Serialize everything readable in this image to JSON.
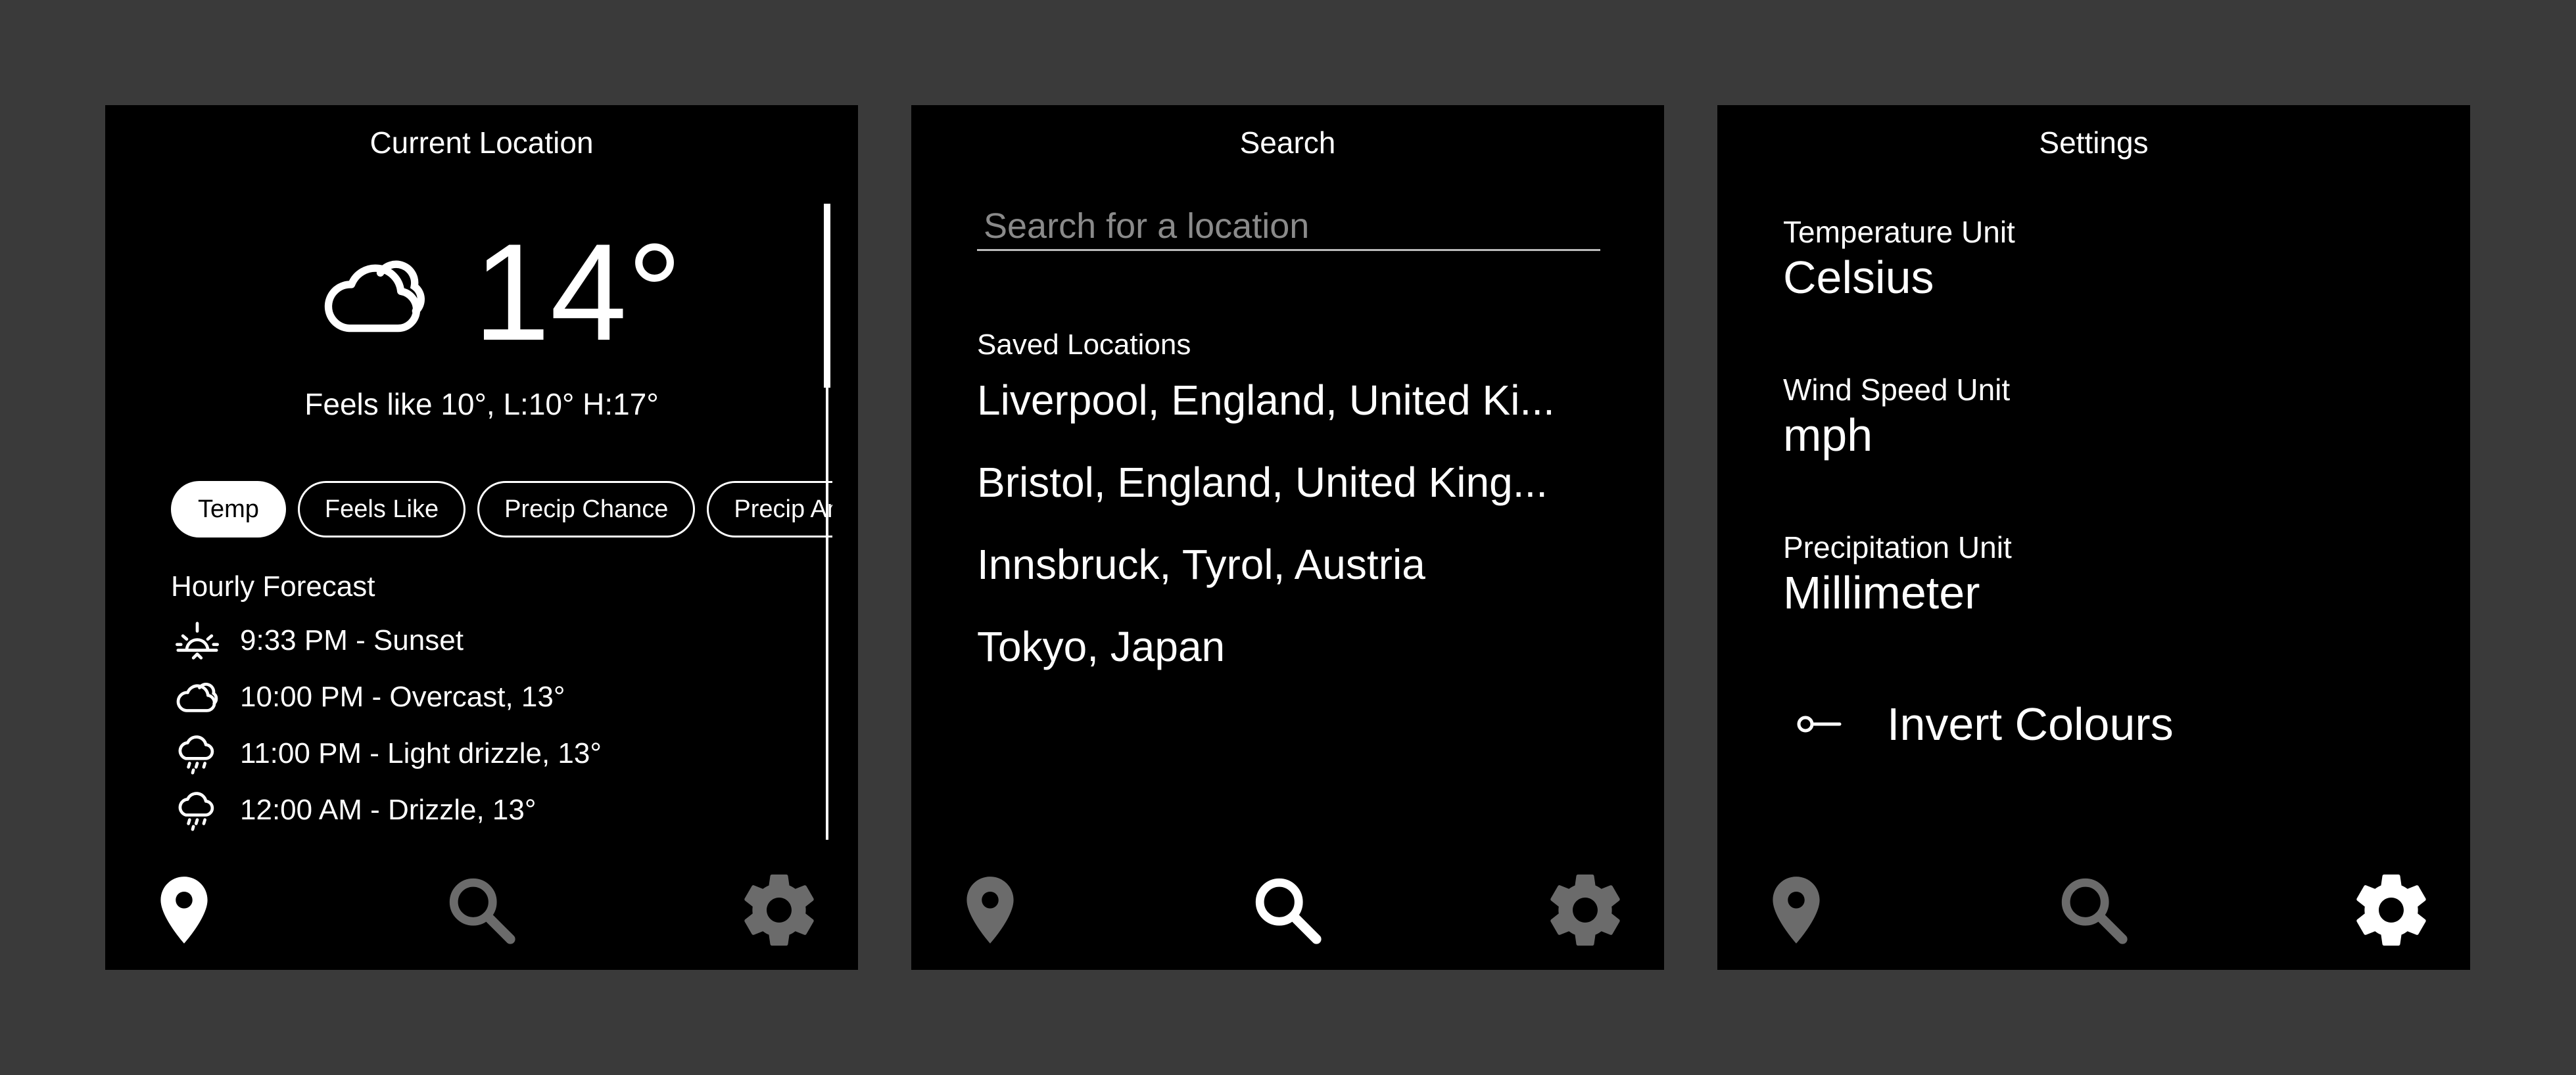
{
  "colors": {
    "background": "#3a3a3a",
    "panel": "#000000",
    "text": "#ffffff",
    "active_nav": "#ffffff",
    "inactive_nav": "#6b6b6b",
    "placeholder": "#8a8a8a"
  },
  "current": {
    "title": "Current Location",
    "weather_icon": "cloud-icon",
    "temperature": "14°",
    "feels_line": "Feels like 10°, L:10° H:17°",
    "chips": [
      {
        "label": "Temp",
        "selected": true
      },
      {
        "label": "Feels Like",
        "selected": false
      },
      {
        "label": "Precip Chance",
        "selected": false
      },
      {
        "label": "Precip Amount",
        "selected": false
      }
    ],
    "hourly_title": "Hourly Forecast",
    "hourly": [
      {
        "icon": "sunset-icon",
        "text": "9:33 PM - Sunset"
      },
      {
        "icon": "cloud-icon",
        "text": "10:00 PM - Overcast, 13°"
      },
      {
        "icon": "cloud-drizzle-icon",
        "text": "11:00 PM - Light drizzle, 13°"
      },
      {
        "icon": "cloud-drizzle-icon",
        "text": "12:00 AM - Drizzle, 13°"
      }
    ]
  },
  "search": {
    "title": "Search",
    "placeholder": "Search for a location",
    "value": "",
    "saved_title": "Saved Locations",
    "locations": [
      "Liverpool, England, United Ki...",
      "Bristol, England, United King...",
      "Innsbruck, Tyrol, Austria",
      "Tokyo, Japan"
    ]
  },
  "settings": {
    "title": "Settings",
    "temperature_label": "Temperature Unit",
    "temperature_value": "Celsius",
    "wind_label": "Wind Speed Unit",
    "wind_value": "mph",
    "precip_label": "Precipitation Unit",
    "precip_value": "Millimeter",
    "invert_label": "Invert Colours",
    "invert_on": false
  },
  "nav": {
    "icons": [
      "location-pin-icon",
      "search-icon",
      "gear-icon"
    ]
  }
}
